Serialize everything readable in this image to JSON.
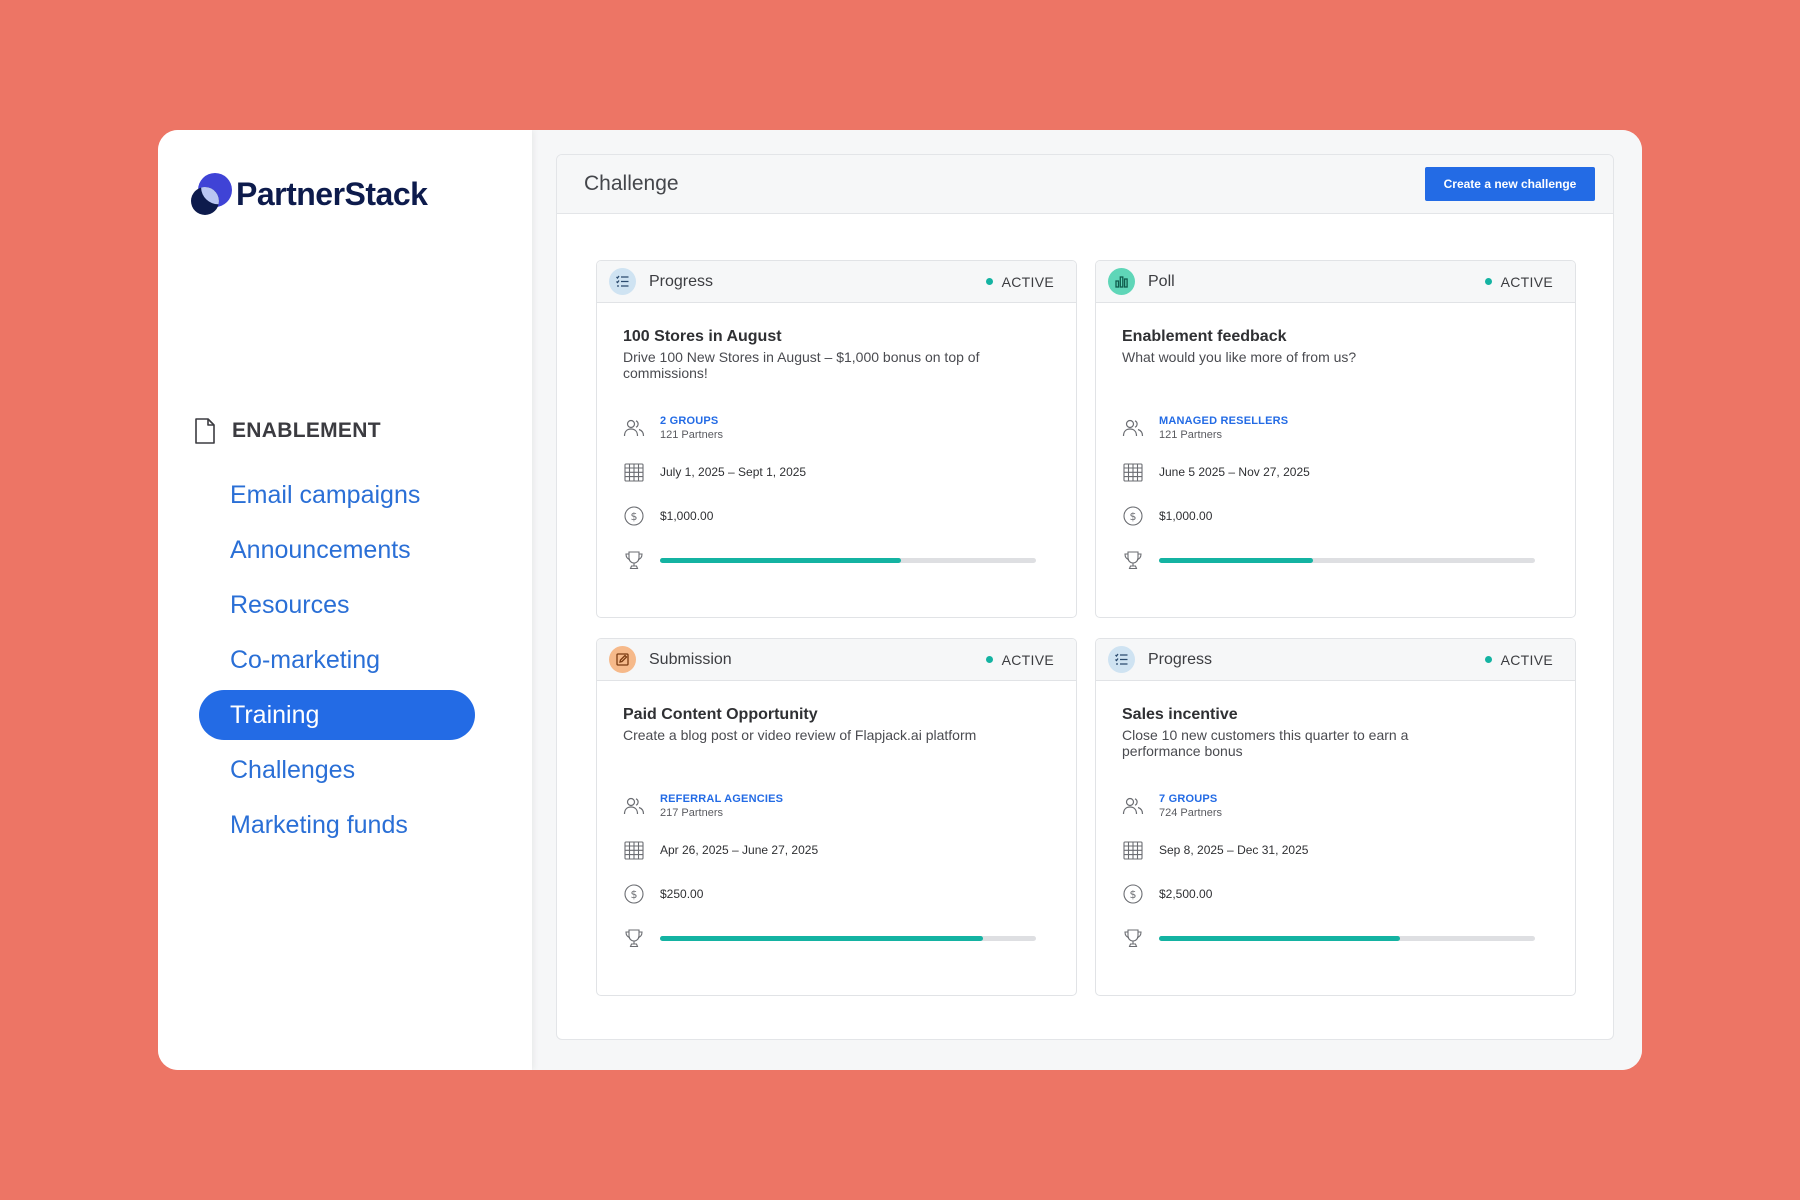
{
  "brand": {
    "name": "PartnerStack",
    "colors": {
      "accent": "#236BE5",
      "navy": "#0d1b4c",
      "teal": "#14b3a2",
      "background": "#ED7565"
    }
  },
  "sidebar": {
    "section_label": "ENABLEMENT",
    "section_icon": "document-icon",
    "items": [
      {
        "label": "Email campaigns",
        "active": false
      },
      {
        "label": "Announcements",
        "active": false
      },
      {
        "label": "Resources",
        "active": false
      },
      {
        "label": "Co-marketing",
        "active": false
      },
      {
        "label": "Training",
        "active": true
      },
      {
        "label": "Challenges",
        "active": false
      },
      {
        "label": "Marketing funds",
        "active": false
      }
    ]
  },
  "main": {
    "title": "Challenge",
    "create_button_label": "Create a new challenge",
    "cards": [
      {
        "type": "Progress",
        "type_icon": "checklist-icon",
        "status": "ACTIVE",
        "title": "100 Stores in August",
        "description": "Drive 100 New Stores in August – $1,000 bonus on top of commissions!",
        "group": "2 GROUPS",
        "partners": "121 Partners",
        "dates": "July 1, 2025 – Sept 1, 2025",
        "amount": "$1,000.00",
        "progress": 0.64
      },
      {
        "type": "Poll",
        "type_icon": "bar-chart-icon",
        "status": "ACTIVE",
        "title": "Enablement feedback",
        "description": "What would you like more of from us?",
        "group": "MANAGED RESELLERS",
        "partners": "121 Partners",
        "dates": "June 5 2025 – Nov 27, 2025",
        "amount": "$1,000.00",
        "progress": 0.41
      },
      {
        "type": "Submission",
        "type_icon": "edit-square-icon",
        "status": "ACTIVE",
        "title": "Paid Content Opportunity",
        "description": "Create a blog post or video review of Flapjack.ai platform",
        "group": "REFERRAL AGENCIES",
        "partners": "217 Partners",
        "dates": "Apr 26, 2025 – June 27, 2025",
        "amount": "$250.00",
        "progress": 0.86
      },
      {
        "type": "Progress",
        "type_icon": "checklist-icon",
        "status": "ACTIVE",
        "title": "Sales incentive",
        "description": "Close 10 new customers this quarter to earn a performance bonus",
        "group": "7 GROUPS",
        "partners": "724 Partners",
        "dates": "Sep 8, 2025 – Dec 31, 2025",
        "amount": "$2,500.00",
        "progress": 0.64
      }
    ]
  }
}
